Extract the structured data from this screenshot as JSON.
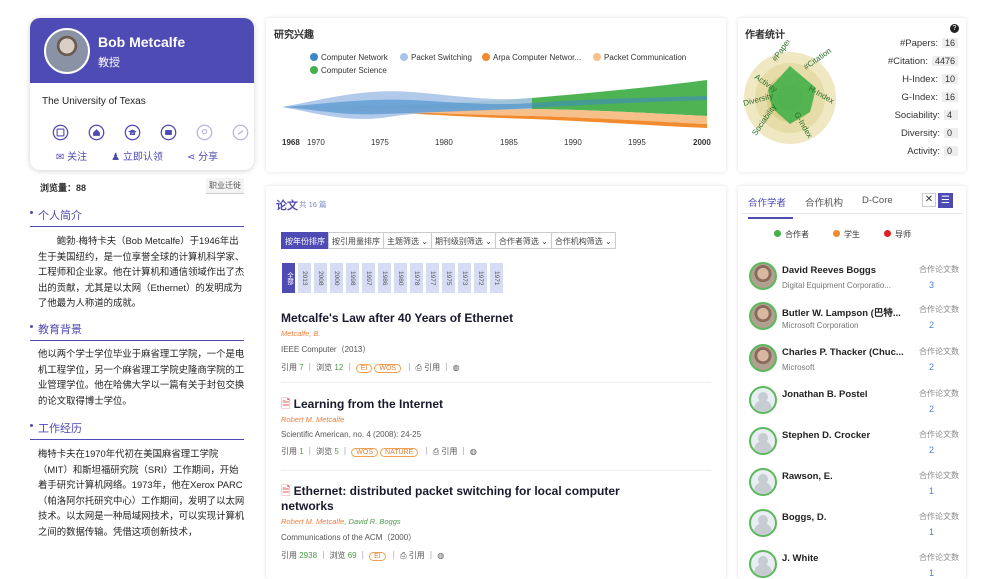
{
  "profile": {
    "name": "Bob Metcalfe",
    "title": "教授",
    "affiliation": "The University of Texas",
    "actions": [
      "关注",
      "立即认领",
      "分享"
    ]
  },
  "views": "浏览量：88",
  "career_button": "职业迁徙",
  "sections": [
    {
      "heading": "个人简介",
      "text": "鲍勃·梅特卡夫（Bob Metcalfe）于1946年出生于美国纽约，是一位享誉全球的计算机科学家、工程师和企业家。他在计算机和通信领域作出了杰出的贡献，尤其是以太网（Ethernet）的发明成为了他最为人称道的成就。"
    },
    {
      "heading": "教育背景",
      "text": "他以两个学士学位毕业于麻省理工学院，一个是电机工程学位，另一个麻省理工学院史隆商学院的工业管理学位。他在哈佛大学以一篇有关于封包交换的论文取得博士学位。"
    },
    {
      "heading": "工作经历",
      "text": "梅特卡夫在1970年代初在美国麻省理工学院（MIT）和斯坦福研究院（SRI）工作期间，开始着手研究计算机网络。1973年，他在Xerox PARC（帕洛阿尔托研究中心）工作期间，发明了以太网技术。以太网是一种局域网技术，可以实现计算机之间的数据传输。凭借这项创新技术，"
    }
  ],
  "interests": {
    "title": "研究兴趣",
    "legend": [
      {
        "name": "Computer Network",
        "color": "#3a86c8"
      },
      {
        "name": "Packet Switching",
        "color": "#a8c4e8"
      },
      {
        "name": "Arpa Computer Networ...",
        "color": "#f28a2e"
      },
      {
        "name": "Packet Communication",
        "color": "#f7c08a"
      },
      {
        "name": "Computer Science",
        "color": "#44b04a"
      }
    ],
    "years": [
      "1968",
      "1970",
      "1975",
      "1980",
      "1985",
      "1990",
      "1995",
      "2000"
    ]
  },
  "stats": {
    "title": "作者统计",
    "help_icon": "?",
    "radar_labels": [
      "#Papers",
      "#Citation",
      "H-Index",
      "G-Index",
      "Sociability",
      "Diversity",
      "Activity"
    ],
    "rows": [
      {
        "label": "#Papers:",
        "value": "16"
      },
      {
        "label": "#Citation:",
        "value": "4476"
      },
      {
        "label": "H-Index:",
        "value": "10"
      },
      {
        "label": "G-Index:",
        "value": "16"
      },
      {
        "label": "Sociability:",
        "value": "4"
      },
      {
        "label": "Diversity:",
        "value": "0"
      },
      {
        "label": "Activity:",
        "value": "0"
      }
    ]
  },
  "papers": {
    "title": "论文",
    "count": "共 16 篇",
    "sort_options": [
      "按年份排序",
      "按引用量排序",
      "主题筛选 ⌄",
      "期刊级别筛选 ⌄",
      "合作者筛选 ⌄",
      "合作机构筛选 ⌄"
    ],
    "year_all": "全部",
    "years": [
      "2013",
      "2008",
      "2000",
      "1998",
      "1997",
      "1986",
      "1980",
      "1978",
      "1977",
      "1975",
      "1973",
      "1972",
      "1971"
    ],
    "items": [
      {
        "title": "Metcalfe's Law after 40 Years of Ethernet",
        "pdf": "",
        "authors": "Metcalfe, B.",
        "coauthors": "",
        "venue": "IEEE Computer（2013）",
        "cite_label": "引用",
        "cites": "7",
        "view_label": "浏览",
        "views": "12",
        "tags": [
          "EI",
          "WOS"
        ],
        "ref": "引用"
      },
      {
        "title": "Learning from the Internet",
        "pdf": "🗎",
        "authors": "Robert M. Metcalfe",
        "coauthors": "",
        "venue": "Scientific American, no. 4 (2008): 24-25",
        "cite_label": "引用",
        "cites": "1",
        "view_label": "浏览",
        "views": "5",
        "tags": [
          "WOS",
          "NATURE"
        ],
        "ref": "引用"
      },
      {
        "title": "Ethernet: distributed packet switching for local computer networks",
        "pdf": "🗎",
        "authors": "Robert M. Metcalfe",
        "coauthors": ", David R. Boggs",
        "venue": "Communications of the ACM（2000）",
        "cite_label": "引用",
        "cites": "2938",
        "view_label": "浏览",
        "views": "69",
        "tags": [
          "EI"
        ],
        "ref": "引用"
      }
    ]
  },
  "coauthors": {
    "tabs": [
      "合作学者",
      "合作机构",
      "D-Core"
    ],
    "graph_icon": "✕",
    "list_icon": "☰",
    "legend": [
      {
        "label": "合作者",
        "color": "#44b04a"
      },
      {
        "label": "学生",
        "color": "#f28a2e"
      },
      {
        "label": "导师",
        "color": "#e02020"
      }
    ],
    "count_label": "合作论文数",
    "items": [
      {
        "name": "David Reeves Boggs",
        "org": "Digital Equipment Corporatio...",
        "count": "3",
        "photo": true
      },
      {
        "name": "Butler W. Lampson (巴特...",
        "org": "Microsoft Corporation",
        "count": "2",
        "photo": true
      },
      {
        "name": "Charles P. Thacker (Chuc...",
        "org": "Microsoft",
        "count": "2",
        "photo": true
      },
      {
        "name": "Jonathan B. Postel",
        "org": "",
        "count": "2",
        "photo": false
      },
      {
        "name": "Stephen D. Crocker",
        "org": "",
        "count": "2",
        "photo": false
      },
      {
        "name": "Rawson, E.",
        "org": "",
        "count": "1",
        "photo": false
      },
      {
        "name": "Boggs, D.",
        "org": "",
        "count": "1",
        "photo": false
      },
      {
        "name": "J. White",
        "org": "",
        "count": "1",
        "photo": false
      }
    ]
  }
}
